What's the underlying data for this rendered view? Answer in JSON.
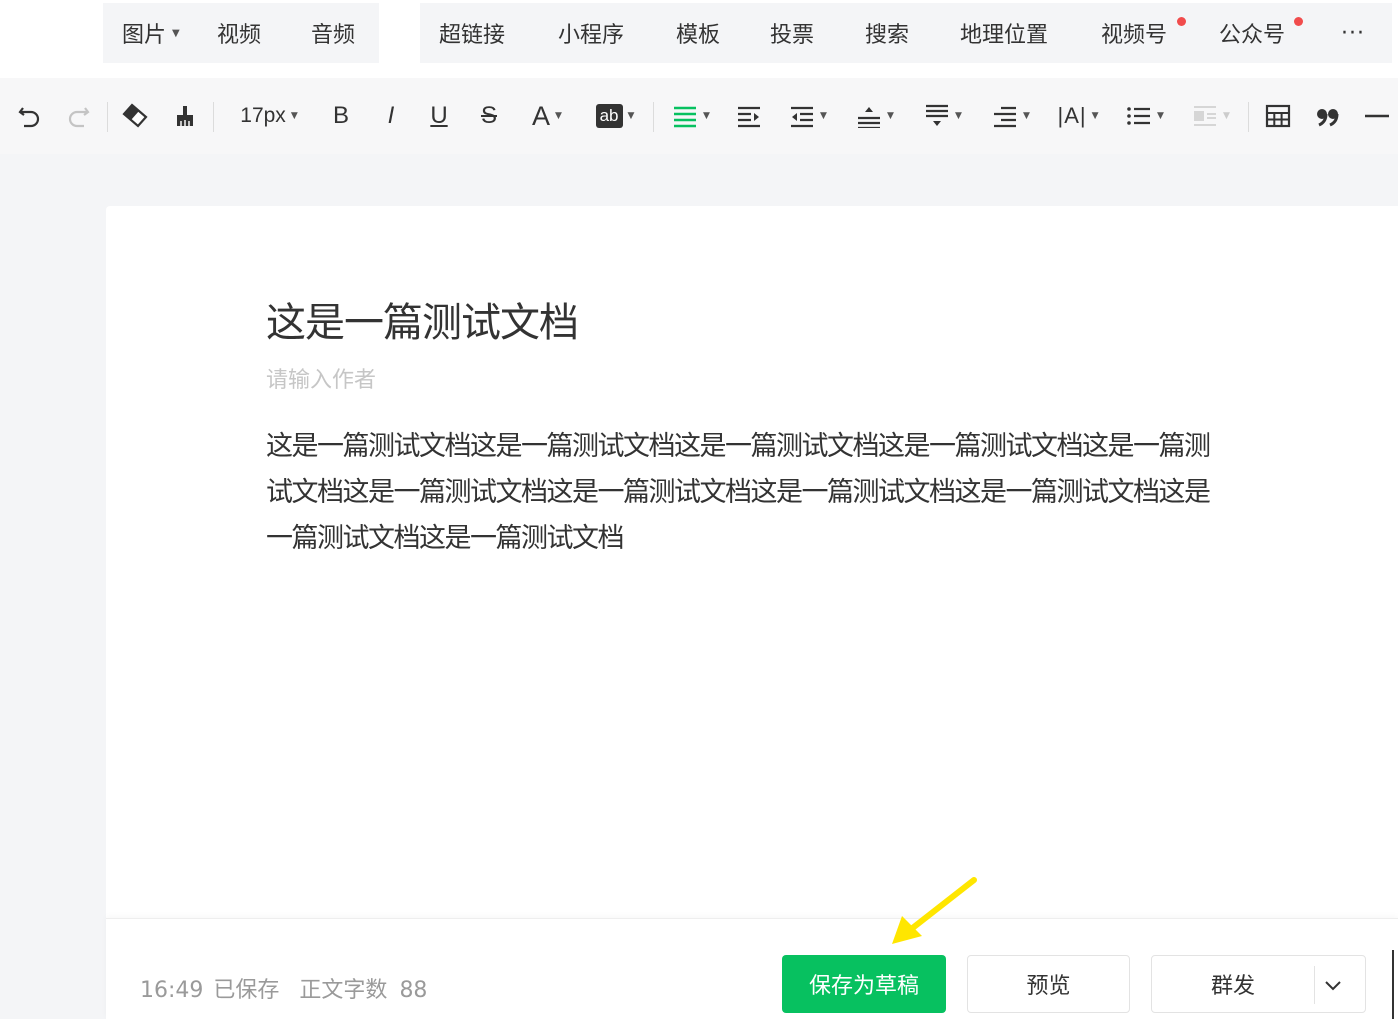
{
  "insert_bar": {
    "group1": [
      {
        "label": "图片",
        "has_caret": true
      },
      {
        "label": "视频"
      },
      {
        "label": "音频"
      }
    ],
    "group2": [
      {
        "label": "超链接"
      },
      {
        "label": "小程序"
      },
      {
        "label": "模板"
      },
      {
        "label": "投票"
      },
      {
        "label": "搜索"
      },
      {
        "label": "地理位置"
      },
      {
        "label": "视频号",
        "badge": "red-dot"
      },
      {
        "label": "公众号",
        "badge": "red-dot"
      }
    ],
    "more_label": "···"
  },
  "toolbar": {
    "font_size": "17px",
    "bold": "B",
    "italic": "I",
    "underline": "U",
    "strike": "S",
    "font_color": "A",
    "bg_color": "ab",
    "line_height": "|A|",
    "icons": [
      "undo-icon",
      "redo-icon",
      "eraser-icon",
      "format-painter-icon",
      "align-icon",
      "indent-icon",
      "outdent-icon",
      "paragraph-spacing-before-icon",
      "paragraph-spacing-after-icon",
      "first-line-indent-icon",
      "letter-spacing-icon",
      "bullet-list-icon",
      "float-icon",
      "table-icon",
      "quote-icon",
      "divider-icon"
    ],
    "accent_color": "#07c160"
  },
  "editor": {
    "title": "这是一篇测试文档",
    "author_placeholder": "请输入作者",
    "body": "这是一篇测试文档这是一篇测试文档这是一篇测试文档这是一篇测试文档这是一篇测试文档这是一篇测试文档这是一篇测试文档这是一篇测试文档这是一篇测试文档这是一篇测试文档这是一篇测试文档"
  },
  "footer": {
    "time": "16:49",
    "saved": "已保存",
    "word_count_label": "正文字数",
    "word_count": "88",
    "save_draft": "保存为草稿",
    "preview": "预览",
    "send": "群发"
  },
  "colors": {
    "primary": "#07c160",
    "badge": "#f14c4c",
    "annotation": "#ffe600"
  }
}
